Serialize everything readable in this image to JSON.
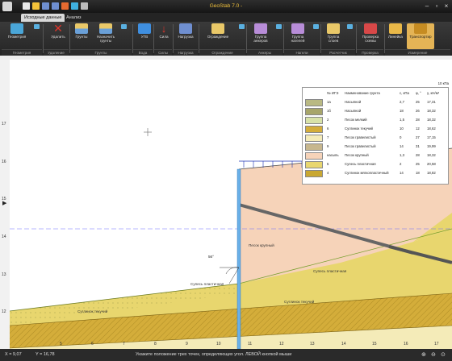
{
  "window": {
    "title": "GeoStab 7.0 -"
  },
  "tabs": [
    {
      "label": "Исходные данные"
    },
    {
      "label": "Анализ"
    }
  ],
  "ribbon": {
    "buttons": [
      {
        "label": "Геометрия"
      },
      {
        "label": "Удалить"
      },
      {
        "label": "Грунты"
      },
      {
        "label": "Назначить грунты"
      },
      {
        "label": "УГВ"
      },
      {
        "label": "Сила"
      },
      {
        "label": "Нагрузка"
      },
      {
        "label": "Ограждение"
      },
      {
        "label": "Группа анкеров"
      },
      {
        "label": "Группа нагелей"
      },
      {
        "label": "Группа слоев"
      },
      {
        "label": "Проверка схемы"
      },
      {
        "label": "Линейка"
      },
      {
        "label": "Транспортир"
      }
    ],
    "groups": [
      {
        "label": "Геометрия"
      },
      {
        "label": "Удаление"
      },
      {
        "label": "Грунты"
      },
      {
        "label": "Вода"
      },
      {
        "label": "Силы"
      },
      {
        "label": "Нагрузка"
      },
      {
        "label": "Ограждение"
      },
      {
        "label": "Анкеры"
      },
      {
        "label": "Нагели"
      },
      {
        "label": "Расчетчик"
      },
      {
        "label": "Проверка"
      },
      {
        "label": "Измерение"
      }
    ]
  },
  "canvas": {
    "y_ticks": [
      "17",
      "16",
      "15",
      "14",
      "13",
      "12"
    ],
    "x_ticks": [
      "5",
      "6",
      "7",
      "8",
      "9",
      "10",
      "11",
      "12",
      "13",
      "14",
      "15",
      "16",
      "17"
    ],
    "load_label": "10 кПа",
    "angle_label": "56°",
    "soil_labels": [
      "Песок крупный",
      "Супесь пластичная",
      "Супесь пластичная",
      "Суглинок текучий",
      "Суглинок текучий"
    ],
    "accent": "#e4b456"
  },
  "legend": {
    "headers": [
      "№ ИГЭ",
      "Наименование грунта",
      "c, кПа",
      "φ, °",
      "γ, кН/м³"
    ],
    "rows": [
      {
        "id": "1а",
        "name": "Насыпной",
        "c": "2,7",
        "phi": "25",
        "gamma": "17,31",
        "color": "#b9b983"
      },
      {
        "id": "1б",
        "name": "Насыпной",
        "c": "18",
        "phi": "26",
        "gamma": "18,32",
        "color": "#a7a56a"
      },
      {
        "id": "2",
        "name": "Песок мелкий",
        "c": "1,5",
        "phi": "28",
        "gamma": "18,32",
        "color": "#d8e2a8"
      },
      {
        "id": "6",
        "name": "Суглинок текучий",
        "c": "10",
        "phi": "12",
        "gamma": "18,62",
        "color": "#d4ad3a"
      },
      {
        "id": "7",
        "name": "Песок гравелистый",
        "c": "0",
        "phi": "27",
        "gamma": "17,15",
        "color": "#f4ebb8"
      },
      {
        "id": "9",
        "name": "Песок гравелистый",
        "c": "14",
        "phi": "31",
        "gamma": "19,99",
        "color": "#c7b78e"
      },
      {
        "id": "насыпь",
        "name": "Песок крупный",
        "c": "1,3",
        "phi": "28",
        "gamma": "18,32",
        "color": "#f6d3b9"
      },
      {
        "id": "5",
        "name": "Супесь пластичная",
        "c": "2",
        "phi": "25",
        "gamma": "20,58",
        "color": "#e8d66e"
      },
      {
        "id": "4",
        "name": "Суглинок мягкопластичный",
        "c": "14",
        "phi": "18",
        "gamma": "18,82",
        "color": "#c9a832"
      }
    ]
  },
  "status": {
    "x": "X = 9,07",
    "y": "Y = 16,78",
    "hint": "Укажите положение трех точек, определяющих угол. ЛЕВОЙ кнопкой мыши"
  }
}
